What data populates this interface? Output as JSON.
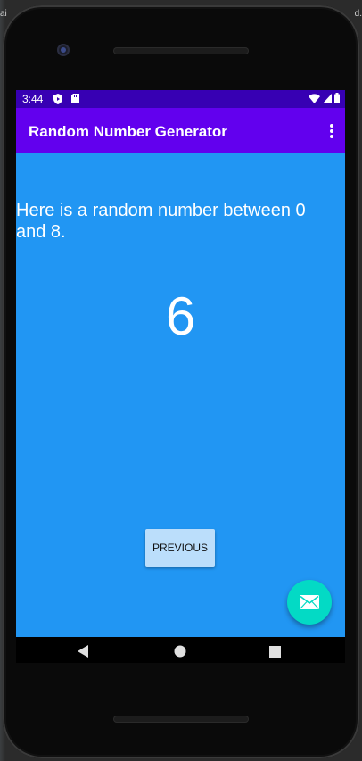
{
  "host": {
    "left_fragment": "ai",
    "right_fragment": "d."
  },
  "status_bar": {
    "time": "3:44",
    "icons": [
      "shield-icon",
      "sd-card-icon",
      "wifi-icon",
      "signal-icon",
      "battery-icon"
    ]
  },
  "app_bar": {
    "title": "Random Number Generator",
    "menu_icon": "more-vert-icon"
  },
  "content": {
    "prompt": "Here is a random number between 0 and 8.",
    "random_value": "6",
    "previous_button_label": "PREVIOUS",
    "fab_icon": "email-icon"
  },
  "nav_bar": {
    "icons": [
      "back-icon",
      "home-icon",
      "recents-icon"
    ]
  },
  "colors": {
    "status_bar": "#3700b3",
    "app_bar": "#6200ee",
    "content_bg": "#2196f3",
    "button_bg": "#bbdefb",
    "fab_bg": "#03dac5"
  }
}
